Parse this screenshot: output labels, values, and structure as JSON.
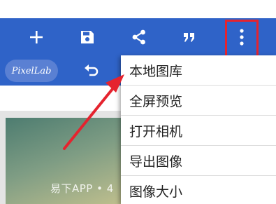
{
  "toolbar": {
    "buttons": [
      {
        "icon": "plus-icon"
      },
      {
        "icon": "save-icon"
      },
      {
        "icon": "share-icon"
      },
      {
        "icon": "quote-icon"
      },
      {
        "icon": "more-vert-icon"
      }
    ],
    "color": "#2f63c8"
  },
  "app": {
    "logo_text": "PixelLab",
    "undo_icon": "undo-icon"
  },
  "menu": {
    "items": [
      {
        "label": "本地图库"
      },
      {
        "label": "全屏预览"
      },
      {
        "label": "打开相机"
      },
      {
        "label": "导出图像"
      },
      {
        "label": "图像大小"
      }
    ]
  },
  "annotation": {
    "highlight_color": "#e5232e",
    "arrow_color": "#e5232e"
  },
  "watermark": {
    "text": "易下APP • 4"
  }
}
